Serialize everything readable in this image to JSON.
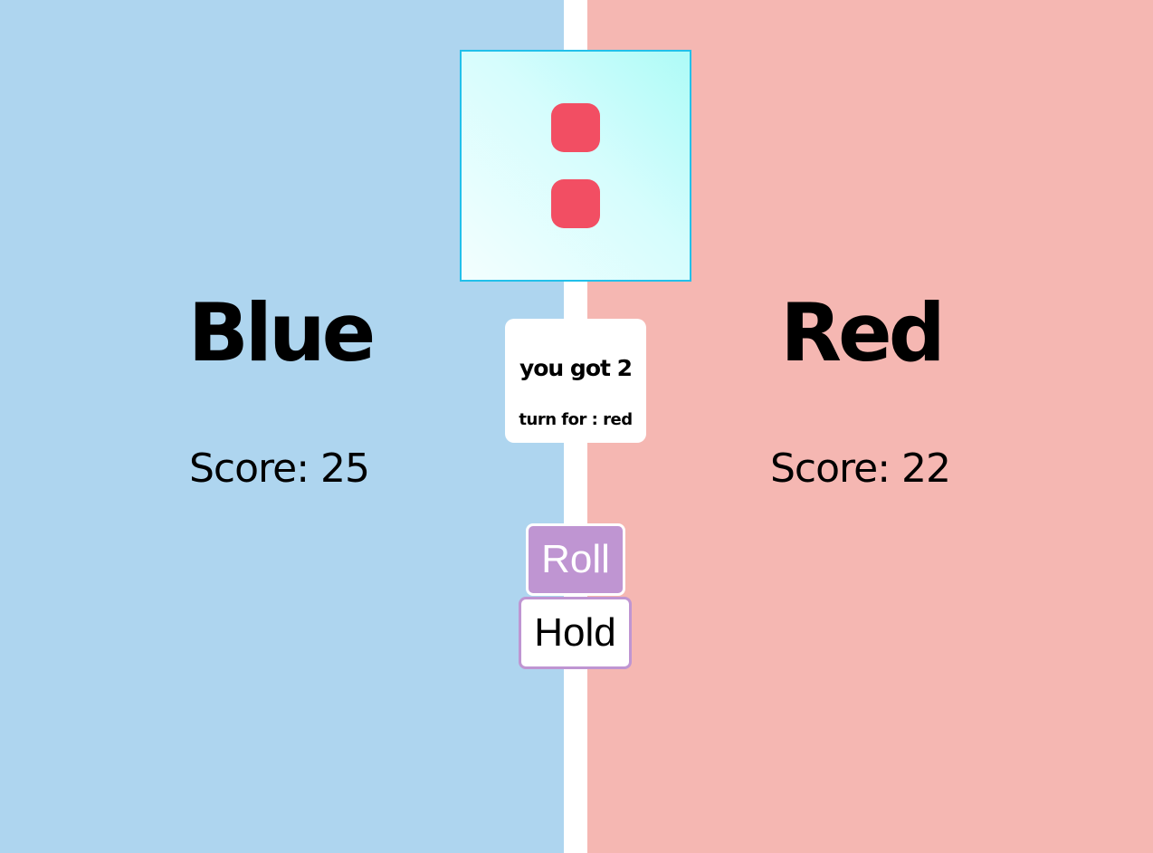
{
  "players": {
    "blue": {
      "name": "Blue",
      "score_text": "Score: 25",
      "score": 25,
      "color": "#aed5ef"
    },
    "red": {
      "name": "Red",
      "score_text": "Score: 22",
      "score": 22,
      "color": "#f5b7b2"
    }
  },
  "dice": {
    "value": 2,
    "pip_color": "#f24e63",
    "border_color": "#22c0ea"
  },
  "message": {
    "roll_result": "you got 2",
    "turn": "turn for : red"
  },
  "controls": {
    "roll_label": "Roll",
    "hold_label": "Hold",
    "accent_color": "#bf95d2"
  }
}
